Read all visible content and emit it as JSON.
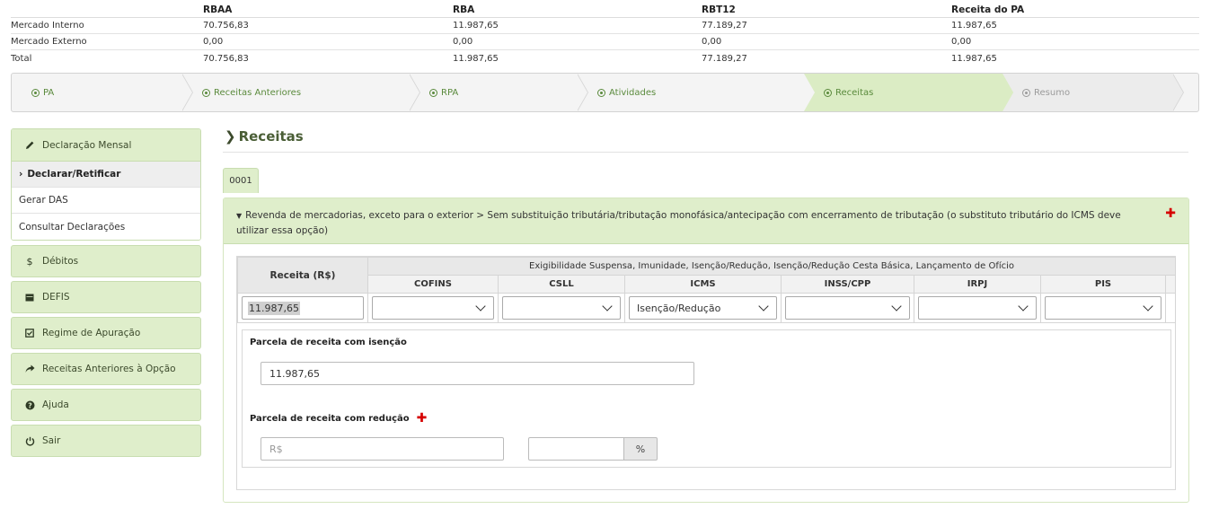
{
  "summary": {
    "headers": [
      "",
      "RBAA",
      "RBA",
      "RBT12",
      "Receita do PA"
    ],
    "rows": [
      [
        "Mercado Interno",
        "70.756,83",
        "11.987,65",
        "77.189,27",
        "11.987,65"
      ],
      [
        "Mercado Externo",
        "0,00",
        "0,00",
        "0,00",
        "0,00"
      ],
      [
        "Total",
        "70.756,83",
        "11.987,65",
        "77.189,27",
        "11.987,65"
      ]
    ]
  },
  "steps": [
    {
      "label": "PA",
      "state": "done"
    },
    {
      "label": "Receitas Anteriores",
      "state": "done"
    },
    {
      "label": "RPA",
      "state": "done"
    },
    {
      "label": "Atividades",
      "state": "done"
    },
    {
      "label": "Receitas",
      "state": "active"
    },
    {
      "label": "Resumo",
      "state": "disabled"
    }
  ],
  "sidebar": {
    "declaracao_mensal": "Declaração Mensal",
    "declarar_retificar": "Declarar/Retificar",
    "gerar_das": "Gerar DAS",
    "consultar_declaracoes": "Consultar Declarações",
    "debitos": "Débitos",
    "defis": "DEFIS",
    "regime": "Regime de Apuração",
    "receitas_anteriores": "Receitas Anteriores à Opção",
    "ajuda": "Ajuda",
    "sair": "Sair"
  },
  "main": {
    "title": "Receitas",
    "tab": "0001",
    "activity": "Revenda de mercadorias, exceto para o exterior > Sem substituição tributária/tributação monofásica/antecipação com encerramento de tributação (o substituto tributário do ICMS deve utilizar essa opção)",
    "grid": {
      "receita_header": "Receita (R$)",
      "group_header": "Exigibilidade Suspensa, Imunidade, Isenção/Redução, Isenção/Redução Cesta Básica, Lançamento de Ofício",
      "columns": [
        "COFINS",
        "CSLL",
        "ICMS",
        "INSS/CPP",
        "IRPJ",
        "PIS"
      ],
      "receita_value": "11.987,65",
      "selected": [
        "",
        "",
        "Isenção/Redução",
        "",
        "",
        ""
      ]
    },
    "parcela_isencao_label": "Parcela de receita com isenção",
    "parcela_isencao_value": "11.987,65",
    "parcela_reducao_label": "Parcela de receita com redução",
    "reducao_placeholder": "R$",
    "percent_symbol": "%"
  },
  "colors": {
    "accent_green": "#dfeecb",
    "title_green": "#4a5e36",
    "step_text": "#5a8a3c",
    "add_red": "#d60000"
  }
}
